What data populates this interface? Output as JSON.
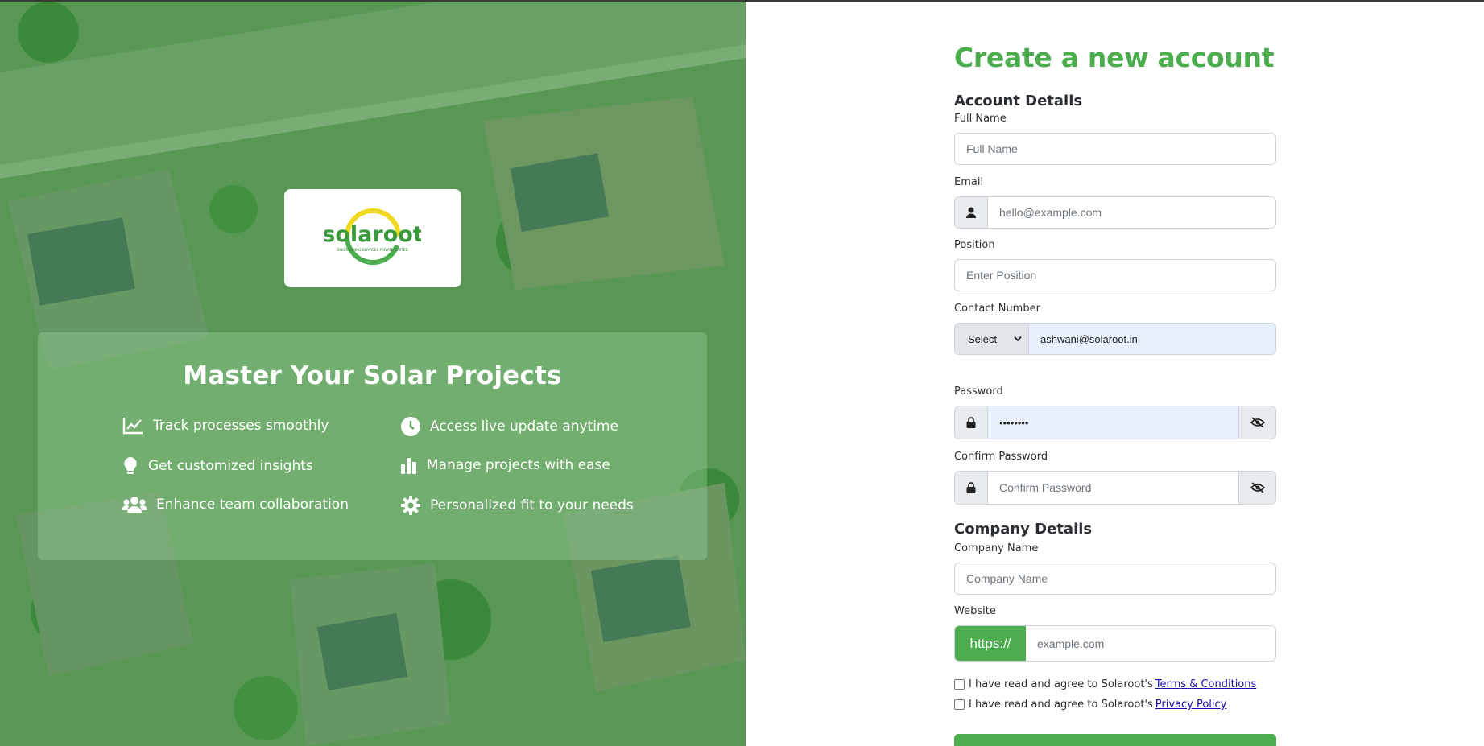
{
  "brand": {
    "name": "solaroot",
    "tagline": "ENGINEERING SERVICES PRIVATE LIMITED"
  },
  "hero": {
    "title": "Master Your Solar Projects",
    "features": [
      {
        "icon": "chart-line-icon",
        "label": "Track processes smoothly"
      },
      {
        "icon": "clock-icon",
        "label": "Access live update anytime"
      },
      {
        "icon": "lightbulb-icon",
        "label": "Get customized insights"
      },
      {
        "icon": "bar-chart-icon",
        "label": "Manage projects with ease"
      },
      {
        "icon": "users-icon",
        "label": "Enhance team collaboration"
      },
      {
        "icon": "gear-icon",
        "label": "Personalized fit to your needs"
      }
    ]
  },
  "form": {
    "title": "Create a new account",
    "account_section": "Account Details",
    "full_name": {
      "label": "Full Name",
      "placeholder": "Full Name"
    },
    "email": {
      "label": "Email",
      "placeholder": "hello@example.com",
      "icon": "user-icon"
    },
    "position": {
      "label": "Position",
      "placeholder": "Enter Position"
    },
    "contact": {
      "label": "Contact Number",
      "select_value": "Select",
      "value": "ashwani@solaroot.in"
    },
    "password": {
      "label": "Password",
      "value": "••••••••",
      "icon": "lock-icon",
      "toggle_icon": "eye-slash-icon"
    },
    "confirm_password": {
      "label": "Confirm Password",
      "placeholder": "Confirm Password",
      "icon": "lock-icon",
      "toggle_icon": "eye-slash-icon"
    },
    "company_section": "Company Details",
    "company_name": {
      "label": "Company Name",
      "placeholder": "Company Name"
    },
    "website": {
      "label": "Website",
      "prefix": "https://",
      "placeholder": "example.com"
    },
    "agree_terms": {
      "text": "I have read and agree to Solaroot's",
      "link": "Terms & Conditions"
    },
    "agree_privacy": {
      "text": "I have read and agree to Solaroot's",
      "link": "Privacy Policy"
    }
  },
  "colors": {
    "accent": "#4cad4e",
    "overlay": "#48a048",
    "input_border": "#ced4da",
    "link": "#1a0dab"
  }
}
